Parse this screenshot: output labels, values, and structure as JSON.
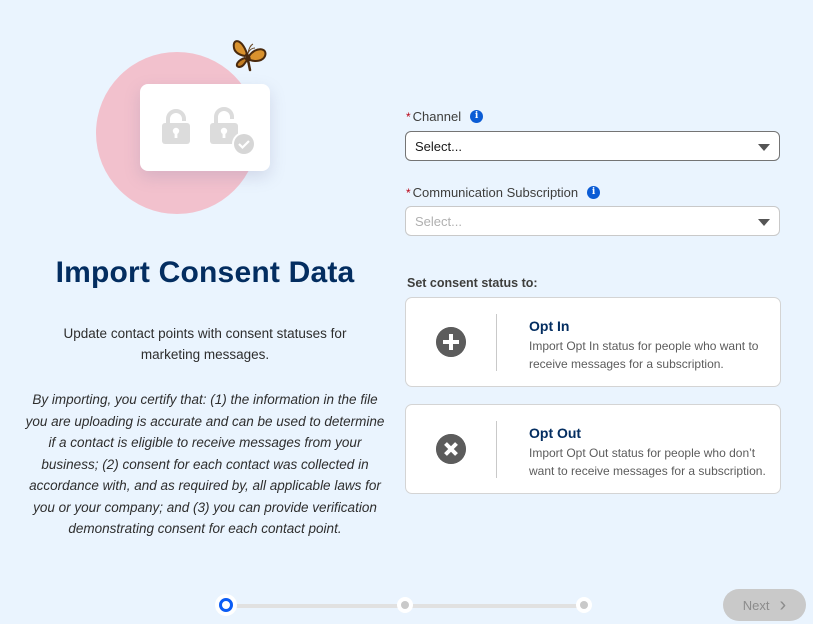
{
  "hero": {
    "icons": [
      "lock-icon",
      "unlock-check-icon",
      "butterfly-icon"
    ]
  },
  "title": "Import Consent Data",
  "subtitle": "Update contact points with consent statuses for marketing messages.",
  "certify_text": "By importing, you certify that: (1) the information in the file you are uploading is accurate and can be used to determine if a contact is eligible to receive messages from your business; (2) consent for each contact was collected in accordance with, and as required by, all applicable laws for you or your company; and (3) you can provide verification demonstrating consent for each contact point.",
  "form": {
    "required_marker": "*",
    "channel": {
      "label": "Channel",
      "value": "Select...",
      "info_glyph": "i"
    },
    "subscription": {
      "label": "Communication Subscription",
      "placeholder": "Select...",
      "info_glyph": "i"
    }
  },
  "consent": {
    "label": "Set consent status to:",
    "options": [
      {
        "title": "Opt In",
        "description": "Import Opt In status for people who want to receive messages for a subscription.",
        "icon": "plus-circle-icon"
      },
      {
        "title": "Opt Out",
        "description": "Import Opt Out status for people who don’t want to receive messages for a subscription.",
        "icon": "x-circle-icon"
      }
    ]
  },
  "progress": {
    "current_step": 1,
    "total_steps": 3
  },
  "footer": {
    "next_label": "Next",
    "next_glyph": "›"
  },
  "colors": {
    "background": "#eaf4fe",
    "title": "#032d60",
    "accent": "#0b5cf5",
    "required": "#ba0517"
  }
}
